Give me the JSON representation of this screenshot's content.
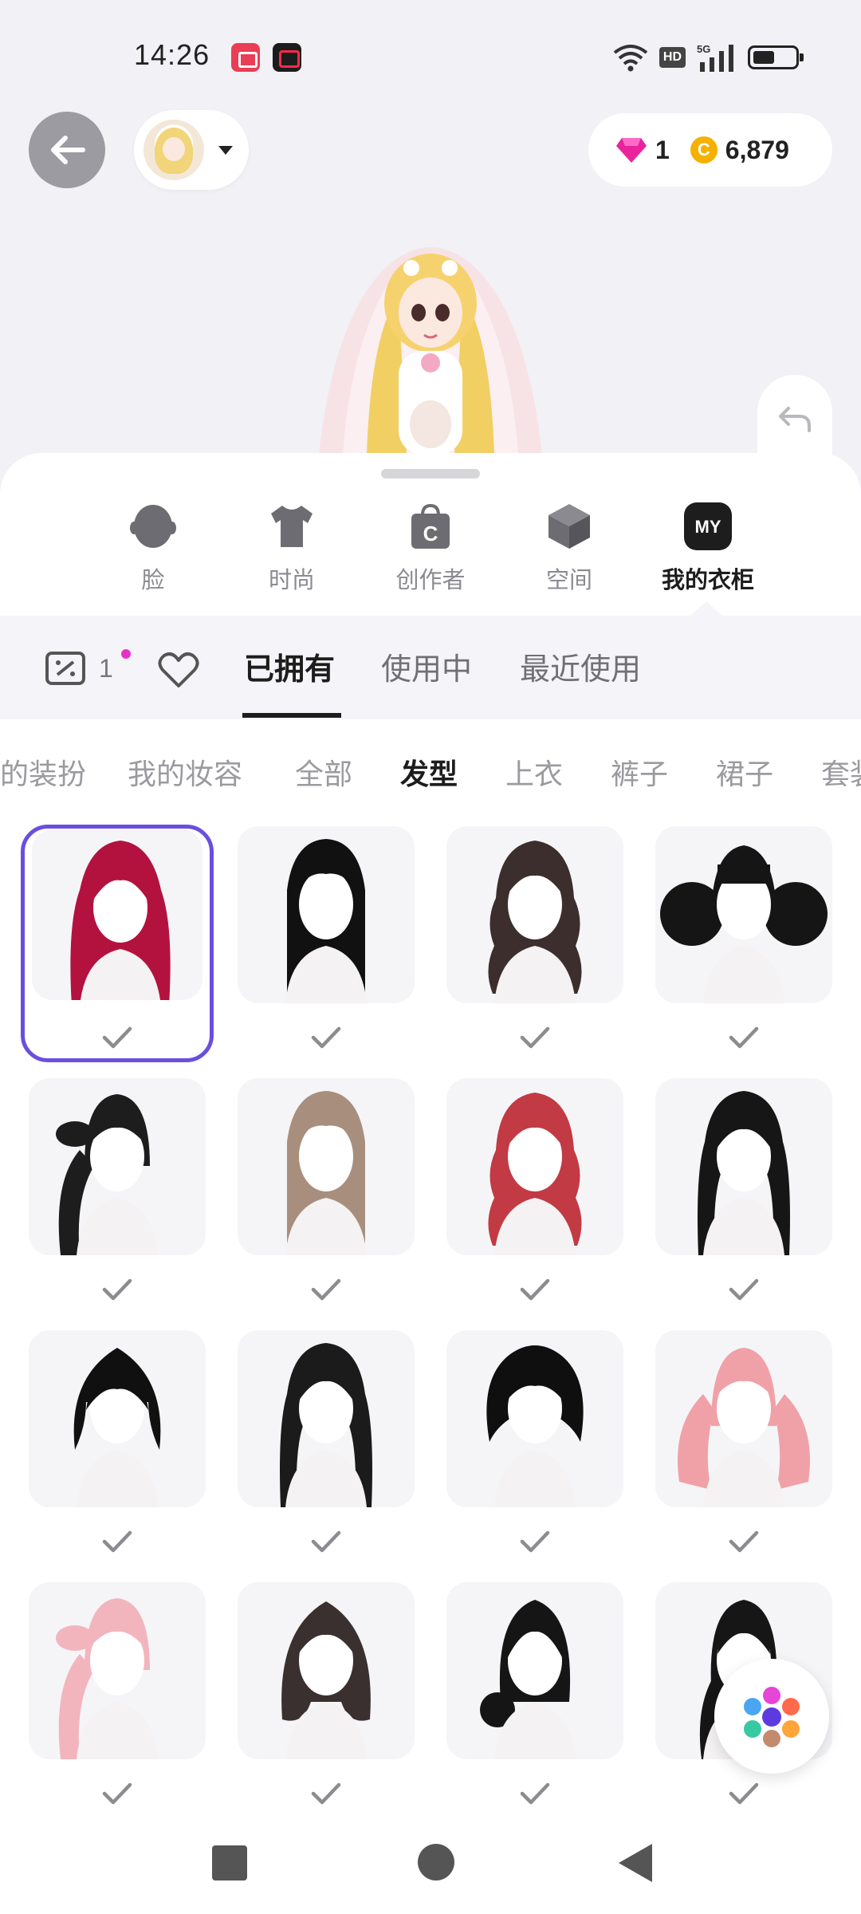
{
  "status_bar": {
    "time": "14:26",
    "hd_badge": "HD",
    "network": "5G"
  },
  "header": {
    "gem_count": "1",
    "coin_count": "6,879",
    "coin_symbol": "C"
  },
  "categories": [
    {
      "label": "脸",
      "icon": "face-icon"
    },
    {
      "label": "时尚",
      "icon": "tshirt-icon"
    },
    {
      "label": "创作者",
      "icon": "creator-bag-icon"
    },
    {
      "label": "空间",
      "icon": "cube-icon"
    },
    {
      "label": "我的衣柜",
      "icon": "my-wardrobe-icon",
      "icon_text": "MY",
      "active": true
    }
  ],
  "filter_bar": {
    "coupon_count": "1",
    "tabs": [
      {
        "label": "已拥有",
        "active": true
      },
      {
        "label": "使用中"
      },
      {
        "label": "最近使用"
      }
    ]
  },
  "sub_tabs": [
    {
      "label": "我的装扮"
    },
    {
      "label": "我的妆容"
    },
    {
      "label": "全部"
    },
    {
      "label": "发型",
      "active": true
    },
    {
      "label": "上衣"
    },
    {
      "label": "裤子"
    },
    {
      "label": "裙子"
    },
    {
      "label": "套装"
    }
  ],
  "hair_items": [
    {
      "name": "red-long-hair",
      "color": "#b3123f",
      "style": "long",
      "selected": true,
      "owned": true
    },
    {
      "name": "black-straight-long-hair",
      "color": "#111111",
      "style": "straight",
      "owned": true
    },
    {
      "name": "brown-wavy-hair",
      "color": "#3b2e2c",
      "style": "wavy",
      "owned": true
    },
    {
      "name": "black-curly-twintails",
      "color": "#151515",
      "style": "twintail-curls",
      "owned": true
    },
    {
      "name": "black-bow-ponytail",
      "color": "#1d1d1d",
      "style": "side-ponytail",
      "owned": true
    },
    {
      "name": "beige-straight-hair",
      "color": "#a88f7d",
      "style": "straight",
      "owned": true
    },
    {
      "name": "red-wavy-hair",
      "color": "#c23a44",
      "style": "wavy",
      "owned": true
    },
    {
      "name": "black-layered-hair",
      "color": "#161616",
      "style": "layered",
      "owned": true
    },
    {
      "name": "black-short-shag",
      "color": "#101010",
      "style": "short",
      "owned": true
    },
    {
      "name": "black-medium-hair",
      "color": "#1b1b1b",
      "style": "medium",
      "owned": true
    },
    {
      "name": "black-messy-short-hair",
      "color": "#0f0f0f",
      "style": "messy",
      "owned": true
    },
    {
      "name": "pink-twintails",
      "color": "#f0a1a8",
      "style": "twintails",
      "owned": true
    },
    {
      "name": "pink-side-ponytail",
      "color": "#f2b5be",
      "style": "side-ponytail",
      "owned": true
    },
    {
      "name": "dark-brown-bob",
      "color": "#3a302f",
      "style": "bob",
      "owned": true
    },
    {
      "name": "black-low-bun",
      "color": "#151515",
      "style": "bun",
      "owned": true
    },
    {
      "name": "black-low-ponytail",
      "color": "#161616",
      "style": "ponytail",
      "owned": true
    }
  ],
  "colors": {
    "accent": "#6a4fdf",
    "gem": "#e8239c",
    "coin": "#f5b000",
    "notification_dot": "#e832c7"
  }
}
